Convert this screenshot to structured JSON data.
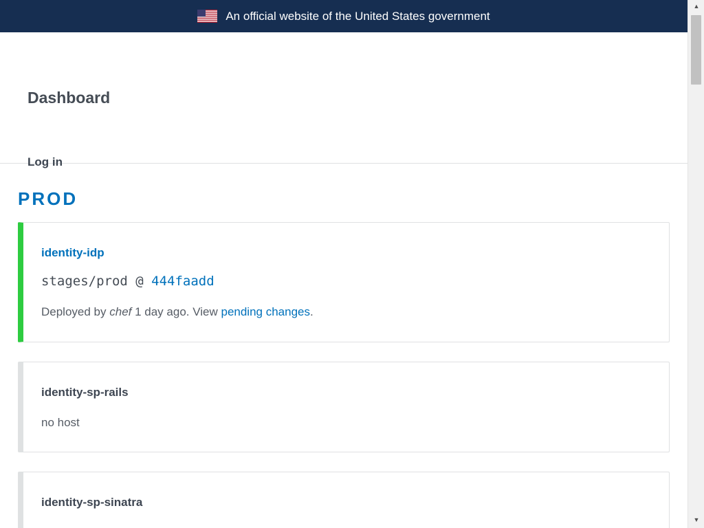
{
  "banner": {
    "text": "An official website of the United States government"
  },
  "header": {
    "title": "Dashboard",
    "login": "Log in"
  },
  "section": {
    "title": "PROD"
  },
  "cards": [
    {
      "name": "identity-idp",
      "ref_prefix": "stages/prod @ ",
      "sha": "444faadd",
      "meta_before": "Deployed by ",
      "meta_user": "chef",
      "meta_middle": " 1 day ago. View ",
      "meta_link": "pending changes",
      "meta_after": ".",
      "status": "ok",
      "status_color": "#2ecc40"
    },
    {
      "name": "identity-sp-rails",
      "detail": "no host"
    },
    {
      "name": "identity-sp-sinatra"
    }
  ],
  "colors": {
    "banner_bg": "#162e51",
    "link": "#0071bb",
    "card_border": "#dfe1e2"
  }
}
